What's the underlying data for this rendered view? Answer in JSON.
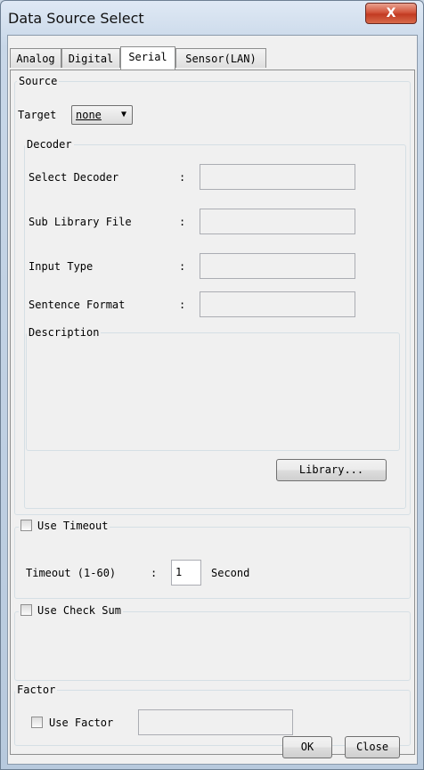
{
  "window": {
    "title": "Data Source Select",
    "close_label": "X"
  },
  "tabs": [
    {
      "label": "Analog"
    },
    {
      "label": "Digital"
    },
    {
      "label": "Serial"
    },
    {
      "label": "Sensor(LAN)"
    }
  ],
  "source": {
    "legend": "Source",
    "target_label": "Target",
    "target_value": "none"
  },
  "decoder": {
    "legend": "Decoder",
    "fields": [
      {
        "label": "Select Decoder",
        "value": ""
      },
      {
        "label": "Sub Library File",
        "value": ""
      },
      {
        "label": "Input Type",
        "value": ""
      },
      {
        "label": "Sentence Format",
        "value": ""
      }
    ],
    "colon": ":",
    "description_legend": "Description",
    "description_text": "",
    "library_button": "Library..."
  },
  "timeout": {
    "legend": "Use Timeout",
    "label": "Timeout (1-60)",
    "colon": ":",
    "value": "1",
    "unit": "Second"
  },
  "checksum": {
    "legend": "Use Check Sum"
  },
  "factor": {
    "legend": "Factor",
    "checkbox_label": "Use Factor",
    "value": ""
  },
  "buttons": {
    "ok": "OK",
    "close": "Close"
  }
}
